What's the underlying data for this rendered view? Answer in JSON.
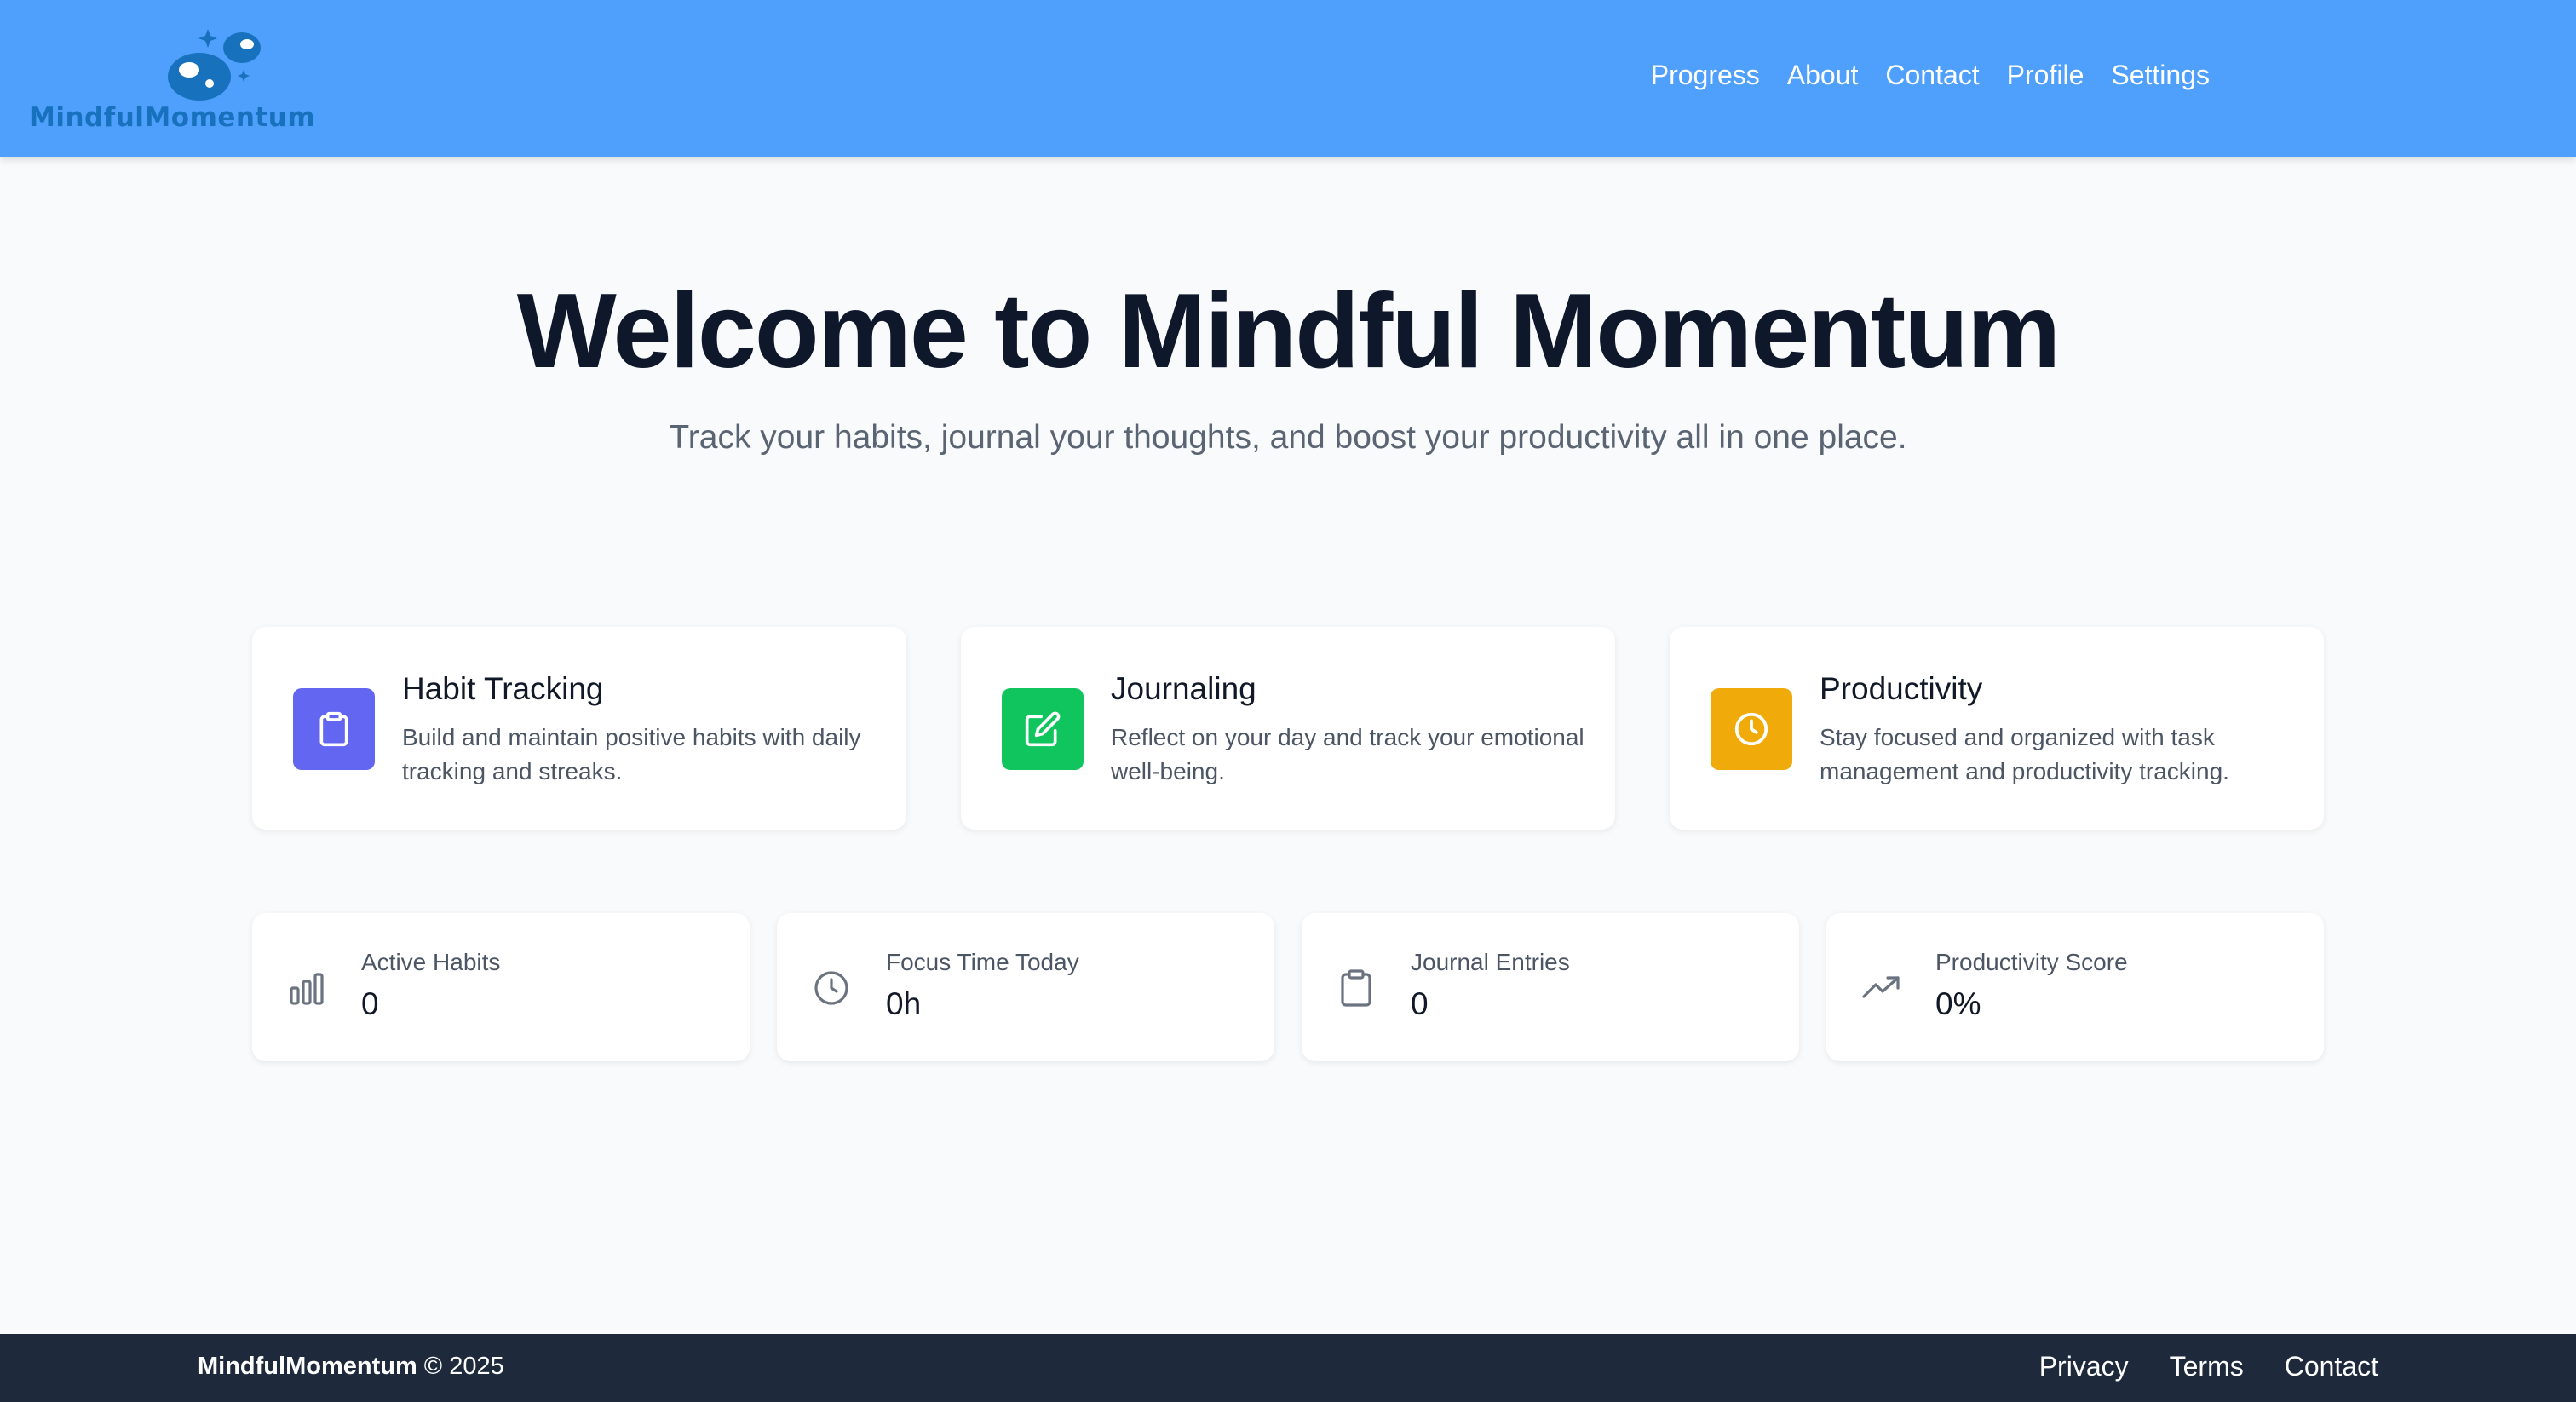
{
  "header": {
    "logo_text": "MindfulMomentum",
    "nav": [
      "Progress",
      "About",
      "Contact",
      "Profile",
      "Settings"
    ]
  },
  "hero": {
    "title": "Welcome to Mindful Momentum",
    "subtitle": "Track your habits, journal your thoughts, and boost your productivity all in one place."
  },
  "features": [
    {
      "title": "Habit Tracking",
      "desc": "Build and maintain positive habits with daily tracking and streaks.",
      "icon": "clipboard-icon",
      "color": "#6366f1"
    },
    {
      "title": "Journaling",
      "desc": "Reflect on your day and track your emotional well-being.",
      "icon": "edit-icon",
      "color": "#10c55e"
    },
    {
      "title": "Productivity",
      "desc": "Stay focused and organized with task management and productivity tracking.",
      "icon": "clock-icon",
      "color": "#f0ab0b"
    }
  ],
  "stats": [
    {
      "label": "Active Habits",
      "value": "0",
      "icon": "bar-chart-icon"
    },
    {
      "label": "Focus Time Today",
      "value": "0h",
      "icon": "clock-icon"
    },
    {
      "label": "Journal Entries",
      "value": "0",
      "icon": "clipboard-icon"
    },
    {
      "label": "Productivity Score",
      "value": "0%",
      "icon": "trending-up-icon"
    }
  ],
  "footer": {
    "brand": "MindfulMomentum",
    "copyright": " © 2025",
    "links": [
      "Privacy",
      "Terms",
      "Contact"
    ]
  },
  "colors": {
    "header_bg": "#4f9ffc",
    "footer_bg": "#1e293b",
    "logo": "#1771bd"
  }
}
